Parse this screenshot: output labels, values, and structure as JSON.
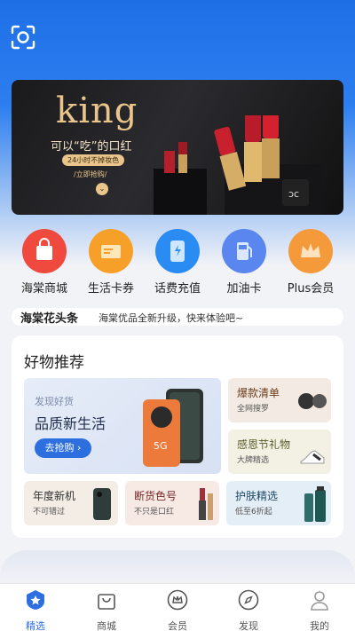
{
  "banner": {
    "headline": "king",
    "subline": "可以“吃”的口红",
    "tag": "24小时不掉妆色",
    "cta": "/立即抢购/"
  },
  "quick_entries": [
    {
      "label": "海棠商城",
      "color": "#f04a3e"
    },
    {
      "label": "生活卡券",
      "color": "#f6a02a"
    },
    {
      "label": "话费充值",
      "color": "#2a8cf2"
    },
    {
      "label": "加油卡",
      "color": "#5a86f0"
    },
    {
      "label": "Plus会员",
      "color": "#f59a3a"
    }
  ],
  "notice": {
    "brand": "海棠花头条",
    "text": "海棠优品全新升级，快来体验吧~"
  },
  "recommend": {
    "title": "好物推荐",
    "main_tile": {
      "small": "发现好货",
      "big": "品质新生活",
      "button": "去抢购 ›"
    },
    "tiles": [
      {
        "title": "爆款清单",
        "sub": "全网搜罗"
      },
      {
        "title": "感恩节礼物",
        "sub": "大牌精选"
      },
      {
        "title": "年度新机",
        "sub": "不可错过"
      },
      {
        "title": "断货色号",
        "sub": "不只是口红"
      },
      {
        "title": "护肤精选",
        "sub": "低至6折起"
      }
    ]
  },
  "tabbar": [
    {
      "label": "精选"
    },
    {
      "label": "商城"
    },
    {
      "label": "会员"
    },
    {
      "label": "发现"
    },
    {
      "label": "我的"
    }
  ]
}
